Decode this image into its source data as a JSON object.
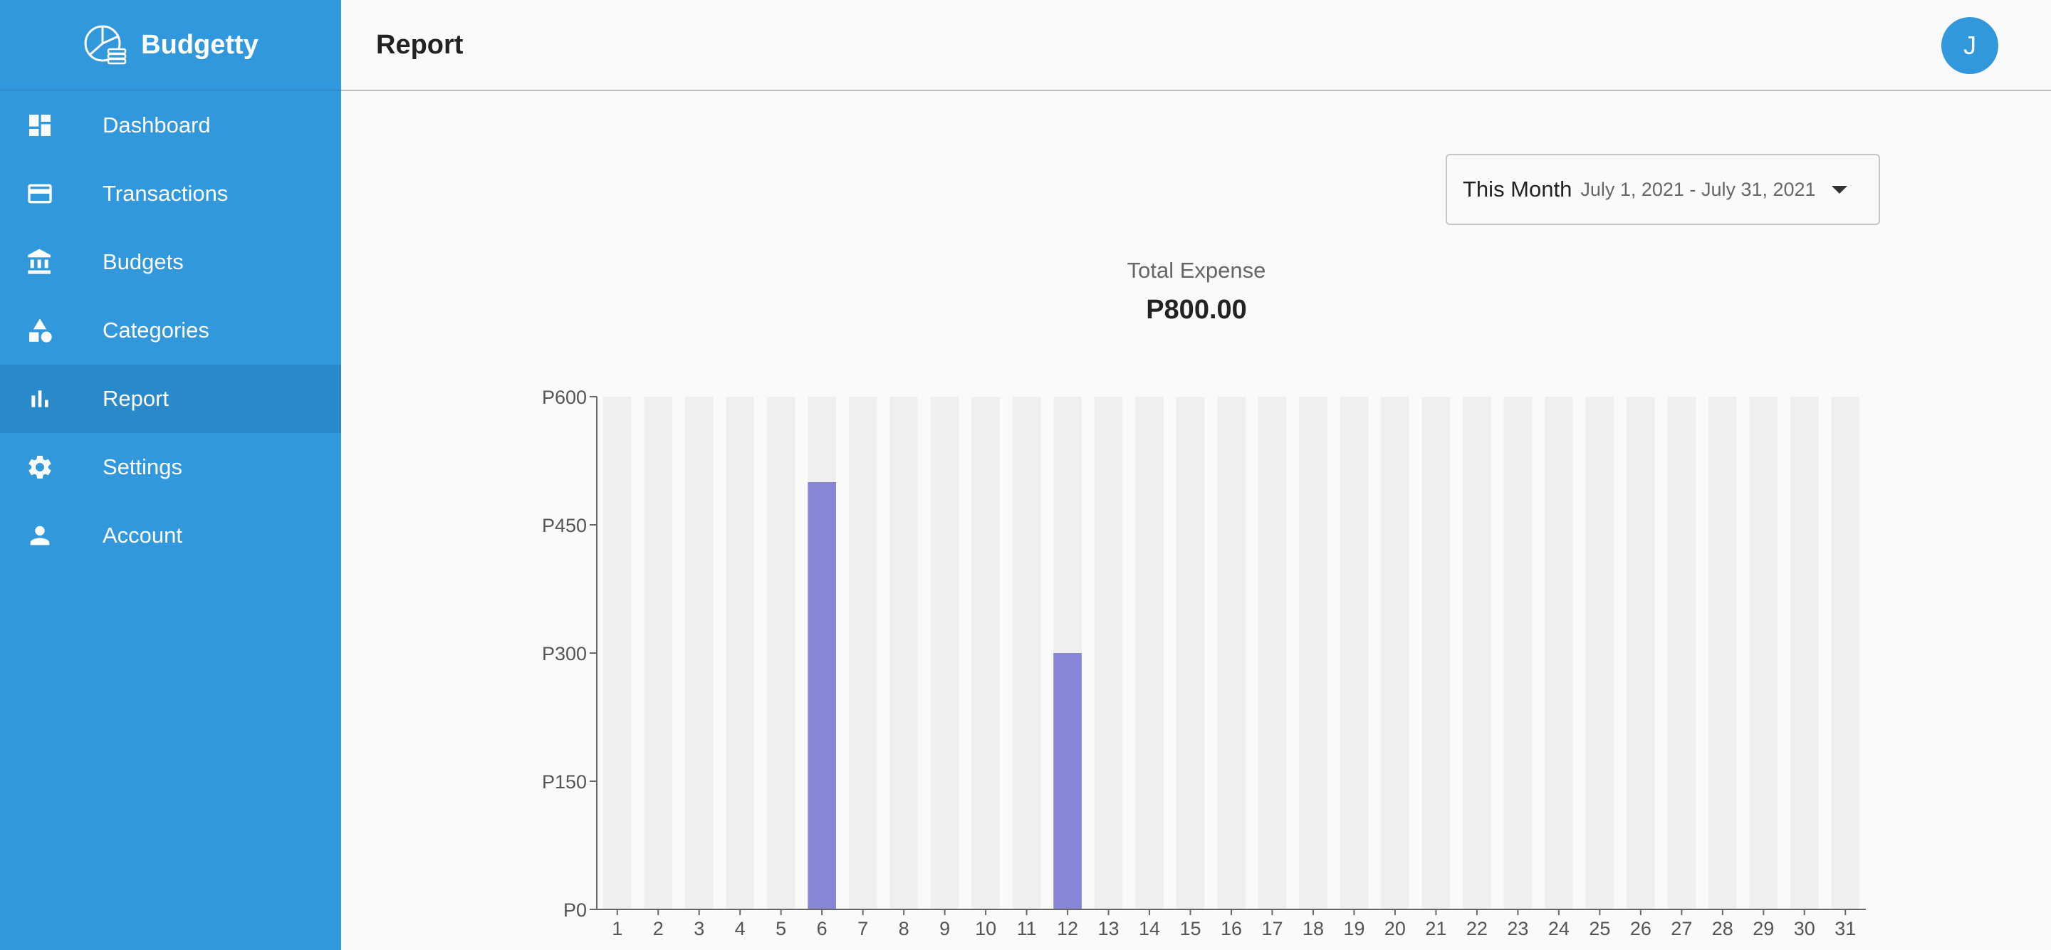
{
  "app": {
    "name": "Budgetty"
  },
  "sidebar": {
    "items": [
      {
        "label": "Dashboard",
        "icon": "dashboard-icon",
        "active": false
      },
      {
        "label": "Transactions",
        "icon": "credit-card-icon",
        "active": false
      },
      {
        "label": "Budgets",
        "icon": "bank-icon",
        "active": false
      },
      {
        "label": "Categories",
        "icon": "shapes-icon",
        "active": false
      },
      {
        "label": "Report",
        "icon": "bar-chart-icon",
        "active": true
      },
      {
        "label": "Settings",
        "icon": "gear-icon",
        "active": false
      },
      {
        "label": "Account",
        "icon": "person-icon",
        "active": false
      }
    ]
  },
  "header": {
    "title": "Report",
    "avatar_initial": "J"
  },
  "range": {
    "label": "This Month",
    "dates": "July 1, 2021 - July 31, 2021"
  },
  "summary": {
    "label": "Total Expense",
    "value": "P800.00"
  },
  "colors": {
    "sidebar": "#3198db",
    "sidebar_active": "#2a89c9",
    "bar": "#8886d6",
    "bar_background": "#efefef"
  },
  "chart_data": {
    "type": "bar",
    "categories": [
      "1",
      "2",
      "3",
      "4",
      "5",
      "6",
      "7",
      "8",
      "9",
      "10",
      "11",
      "12",
      "13",
      "14",
      "15",
      "16",
      "17",
      "18",
      "19",
      "20",
      "21",
      "22",
      "23",
      "24",
      "25",
      "26",
      "27",
      "28",
      "29",
      "30",
      "31"
    ],
    "values": [
      0,
      0,
      0,
      0,
      0,
      500,
      0,
      0,
      0,
      0,
      0,
      300,
      0,
      0,
      0,
      0,
      0,
      0,
      0,
      0,
      0,
      0,
      0,
      0,
      0,
      0,
      0,
      0,
      0,
      0,
      0
    ],
    "yticks": [
      0,
      150,
      300,
      450,
      600
    ],
    "ytick_labels": [
      "P0",
      "P150",
      "P300",
      "P450",
      "P600"
    ],
    "ylim": [
      0,
      600
    ],
    "grid": false,
    "background_bars": true
  }
}
